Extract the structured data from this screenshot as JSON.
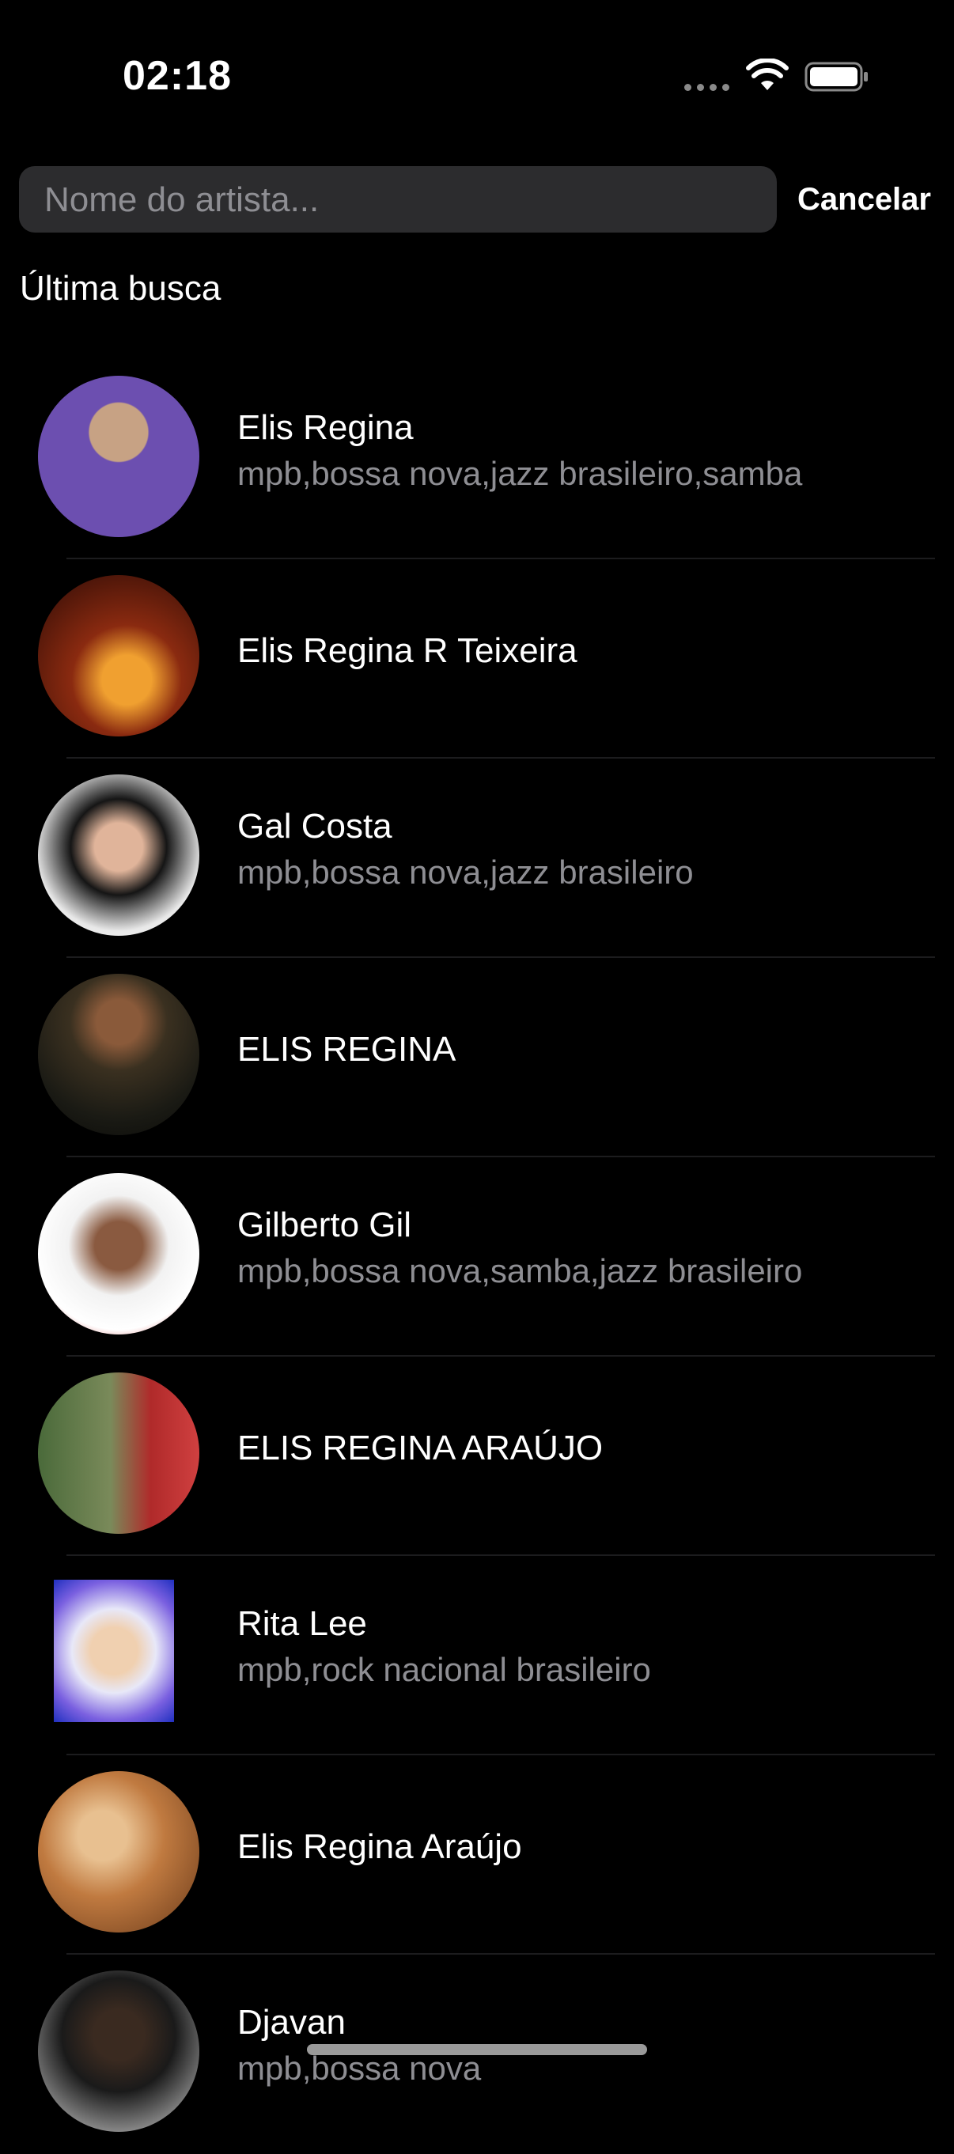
{
  "status_bar": {
    "time": "02:18",
    "icons": [
      "signal-dots-icon",
      "wifi-icon",
      "battery-icon"
    ]
  },
  "search": {
    "placeholder": "Nome do artista...",
    "value": "",
    "cancel_label": "Cancelar"
  },
  "section": {
    "title": "Última busca"
  },
  "artists": [
    {
      "name": "Elis Regina",
      "genres": "mpb,bossa nova,jazz brasileiro,samba",
      "avatar": "portrait"
    },
    {
      "name": "Elis Regina R Teixeira",
      "genres": "",
      "avatar": "album-cover"
    },
    {
      "name": "Gal Costa",
      "genres": "mpb,bossa nova,jazz brasileiro",
      "avatar": "portrait"
    },
    {
      "name": "ELIS REGINA",
      "genres": "",
      "avatar": "album-cover"
    },
    {
      "name": "Gilberto Gil",
      "genres": "mpb,bossa nova,samba,jazz brasileiro",
      "avatar": "portrait"
    },
    {
      "name": "ELIS REGINA ARAÚJO",
      "genres": "",
      "avatar": "album-cover"
    },
    {
      "name": "Rita Lee",
      "genres": "mpb,rock nacional brasileiro",
      "avatar": "portrait"
    },
    {
      "name": "Elis Regina Araújo",
      "genres": "",
      "avatar": "album-cover"
    },
    {
      "name": "Djavan",
      "genres": "mpb,bossa nova",
      "avatar": "portrait"
    }
  ],
  "colors": {
    "background": "#000000",
    "search_field": "#2c2c2e",
    "secondary_text": "#8e8e93",
    "separator": "#1c1c1e"
  }
}
